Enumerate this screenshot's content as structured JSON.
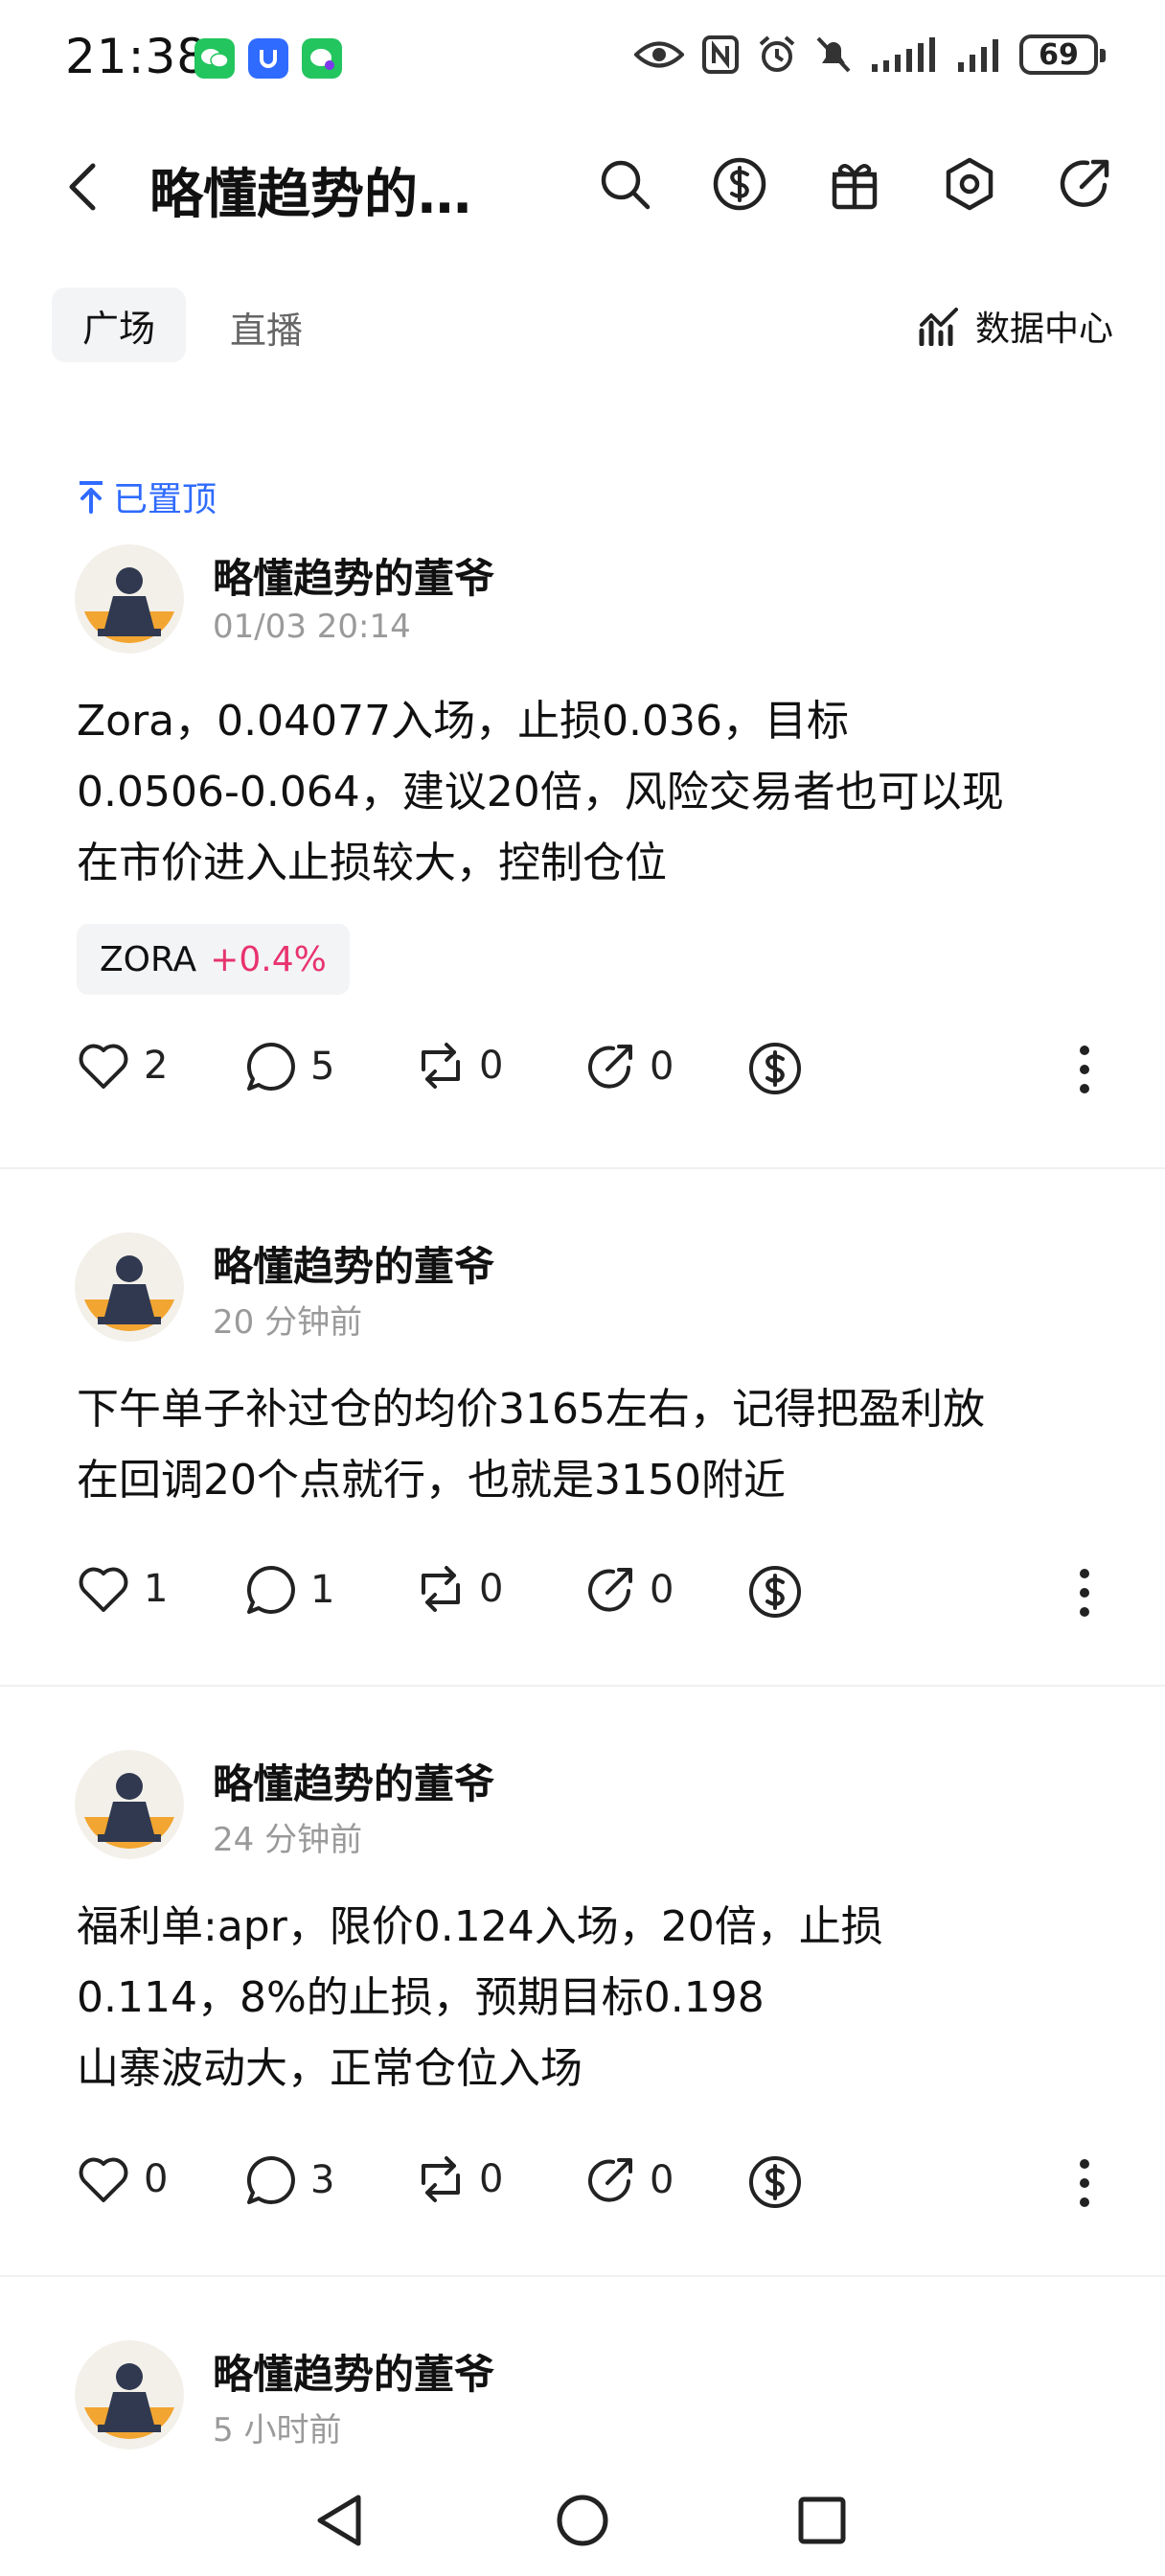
{
  "status_bar": {
    "time": "21:38",
    "battery": "69"
  },
  "header": {
    "title": "略懂趋势的…"
  },
  "tabs": {
    "square": "广场",
    "live": "直播",
    "data_center": "数据中心"
  },
  "posts": [
    {
      "pinned_label": "已置顶",
      "author": "略懂趋势的董爷",
      "time": "01/03 20:14",
      "content_lines": [
        "Zora，0.04077入场，止损0.036，目标",
        "0.0506-0.064，建议20倍，风险交易者也可以现",
        "在市价进入止损较大，控制仓位"
      ],
      "ticker": {
        "symbol": "ZORA",
        "change": "+0.4%"
      },
      "likes": "2",
      "comments": "5",
      "reposts": "0",
      "shares": "0"
    },
    {
      "author": "略懂趋势的董爷",
      "time": "20 分钟前",
      "content_lines": [
        "下午单子补过仓的均价3165左右，记得把盈利放",
        "在回调20个点就行，也就是3150附近"
      ],
      "likes": "1",
      "comments": "1",
      "reposts": "0",
      "shares": "0"
    },
    {
      "author": "略懂趋势的董爷",
      "time": "24 分钟前",
      "content_lines": [
        "福利单:apr，限价0.124入场，20倍，止损",
        "0.114，8%的止损，预期目标0.198",
        "山寨波动大，正常仓位入场"
      ],
      "likes": "0",
      "comments": "3",
      "reposts": "0",
      "shares": "0"
    },
    {
      "author": "略懂趋势的董爷",
      "time": "5 小时前"
    }
  ],
  "colors": {
    "accent_blue": "#2f6bff",
    "positive_change": "#e8336e",
    "muted_text": "#9a9a9a",
    "tab_bg": "#f3f4f6"
  }
}
